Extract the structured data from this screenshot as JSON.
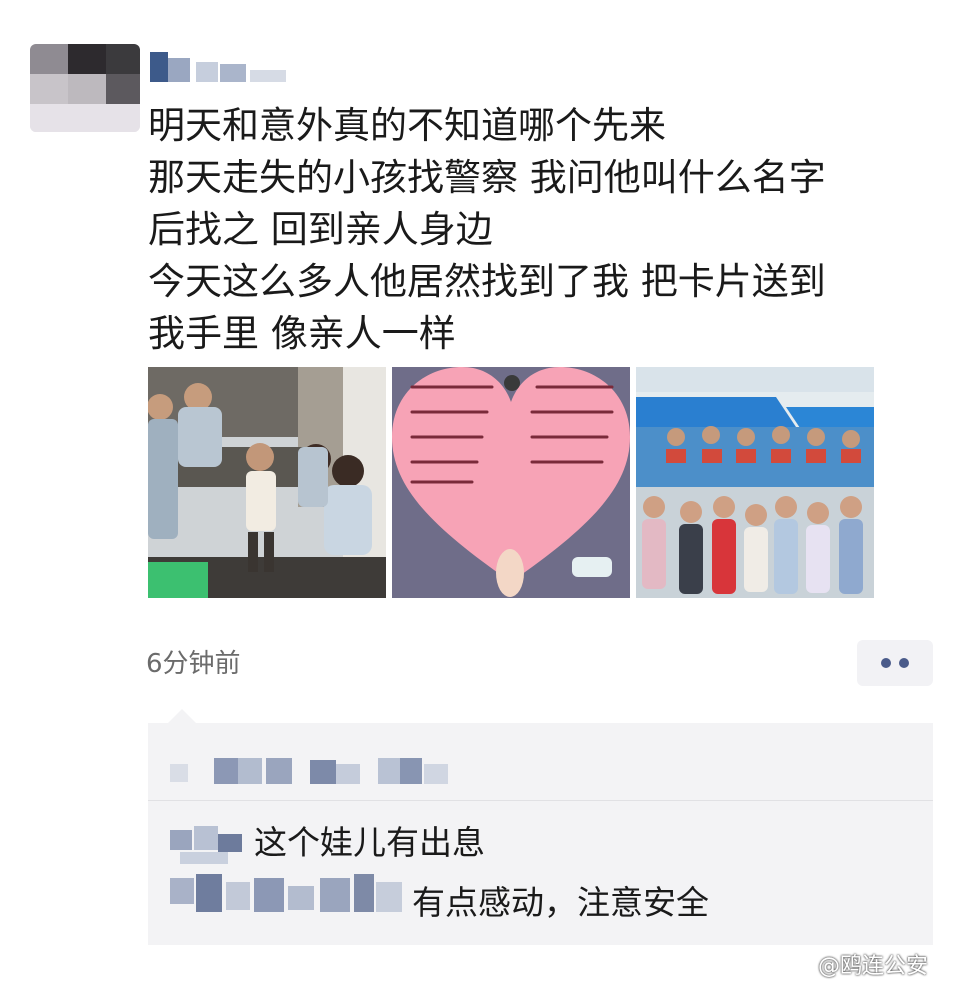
{
  "post": {
    "lines": [
      "明天和意外真的不知道哪个先来",
      "那天走失的小孩找警察 我问他叫什么名字",
      "后找之 回到亲人身边",
      "今天这么多人他居然找到了我 把卡片送到",
      "我手里 像亲人一样"
    ],
    "timestamp": "6分钟前"
  },
  "photos": [
    {
      "subject": "police-with-child-photo"
    },
    {
      "subject": "heart-card-photo"
    },
    {
      "subject": "group-children-police-photo"
    }
  ],
  "comments": [
    {
      "text": "这个娃儿有出息"
    },
    {
      "text": "有点感动，注意安全"
    }
  ],
  "watermark": "@鸥连公安",
  "colors": {
    "link_blue": "#4a5b8a",
    "comment_bg": "#f3f3f5",
    "timestamp_gray": "#6b6b6b"
  }
}
